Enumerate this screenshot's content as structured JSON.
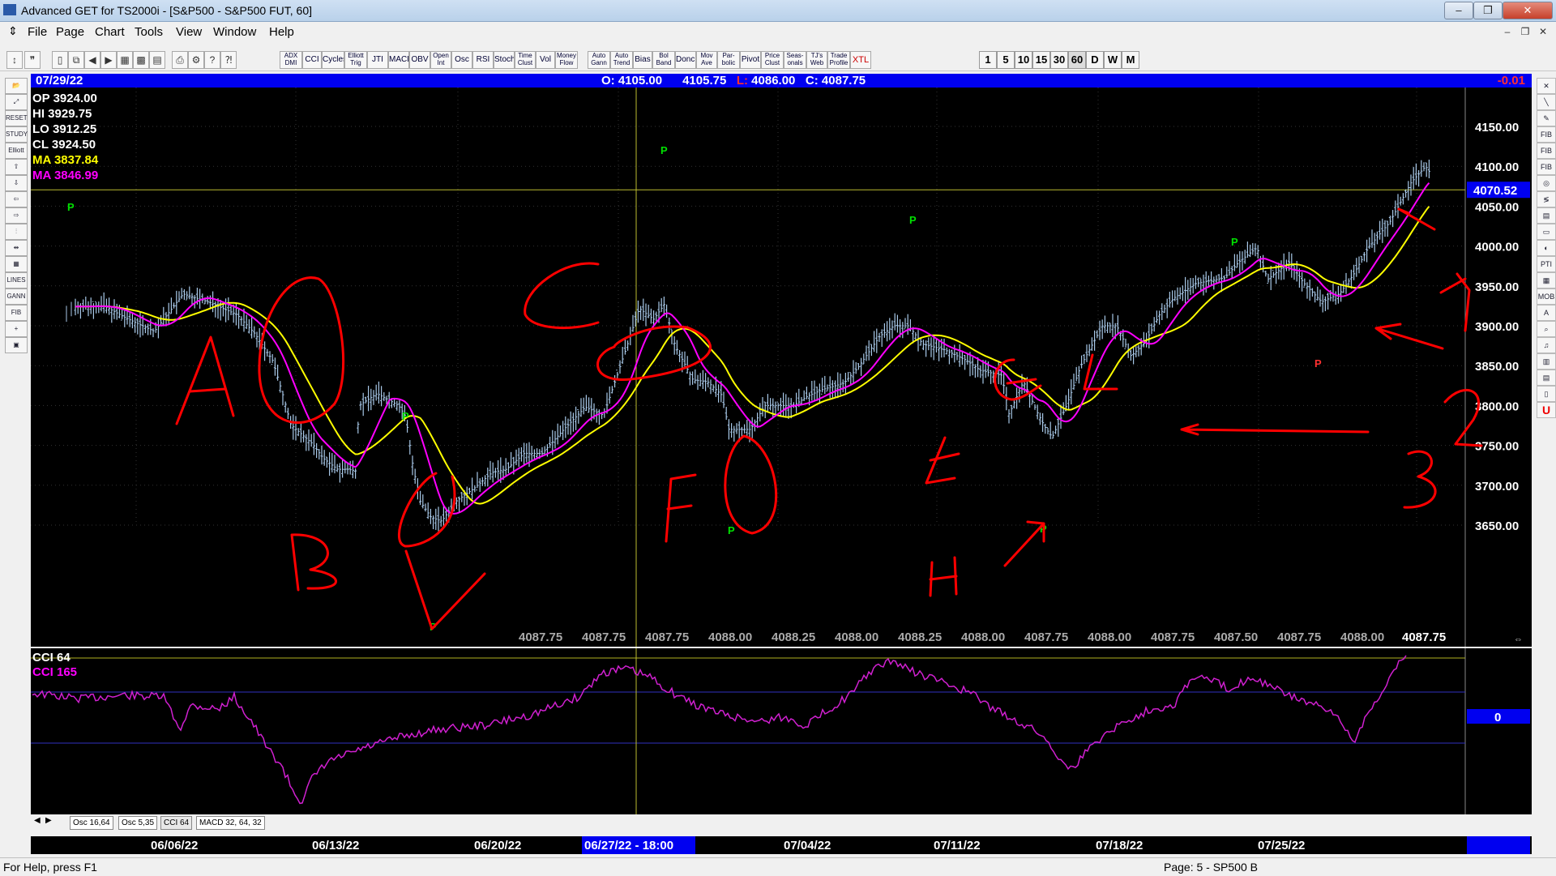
{
  "window": {
    "title": "Advanced GET for TS2000i - [S&P500 - S&P500 FUT, 60]",
    "controls": [
      "–",
      "❐",
      "✕"
    ]
  },
  "menu": [
    "File",
    "Page",
    "Chart",
    "Tools",
    "View",
    "Window",
    "Help"
  ],
  "toolbar": {
    "studies": [
      "ADX DMI",
      "CCI",
      "Cycles",
      "Elliott Trig",
      "JTI",
      "MACD",
      "OBV",
      "Open Int",
      "Osc",
      "RSI",
      "Stoch",
      "Time Clust",
      "Vol",
      "Money Flow",
      "Auto Gann",
      "Auto Trend",
      "Bias",
      "Bol Band",
      "Donch",
      "Mov Ave",
      "Par- bolic",
      "Pivot",
      "Price Clust",
      "Seas- onals",
      "TJ's Web",
      "Trade Profile",
      "XTL"
    ],
    "timeframes": [
      "1",
      "5",
      "10",
      "15",
      "30",
      "60",
      "D",
      "W",
      "M"
    ],
    "active_timeframe": "60"
  },
  "header": {
    "date": "07/29/22",
    "open": "O: 4105.00",
    "high": "4105.75",
    "low_label": "L:",
    "low": "4086.00",
    "close": "C: 4087.75",
    "change": "-0.01"
  },
  "legend": {
    "op": "OP  3924.00",
    "hi": "HI   3929.75",
    "lo": "LO  3912.25",
    "cl": "CL  3924.50",
    "ma1": "MA  3837.84",
    "ma2": "MA  3846.99"
  },
  "price_axis": {
    "ticks": [
      "4150.00",
      "4100.00",
      "4050.00",
      "4000.00",
      "3950.00",
      "3900.00",
      "3850.00",
      "3800.00",
      "3750.00",
      "3700.00",
      "3650.00"
    ],
    "current": "4070.52"
  },
  "bottom_values": [
    "4087.75",
    "4087.75",
    "4087.75",
    "4088.00",
    "4088.25",
    "4088.00",
    "4088.25",
    "4088.00",
    "4087.75",
    "4088.00",
    "4087.75",
    "4087.50",
    "4087.75",
    "4088.00",
    "4087.75"
  ],
  "pivot_label": "P",
  "cci": {
    "label1": "CCI 64",
    "label2": "CCI  165",
    "zero": "0"
  },
  "tabs": [
    "Osc 16,64",
    "Osc 5,35",
    "CCI 64",
    "MACD 32, 64, 32"
  ],
  "date_axis": {
    "labels": [
      "06/06/22",
      "06/13/22",
      "06/20/22",
      "06/27/22 - 18:00",
      "07/04/22",
      "07/11/22",
      "07/18/22",
      "07/25/22"
    ]
  },
  "annotations": {
    "letters": [
      "A",
      "B",
      "C",
      "F",
      "G",
      "H",
      "L",
      "1",
      "2",
      "3"
    ]
  },
  "status": {
    "left": "For Help, press F1",
    "right": "Page: 5 - SP500 B"
  },
  "colors": {
    "ma_yellow": "#ffff00",
    "ma_magenta": "#ff00ff",
    "bars": "#a8c8e8",
    "header_blue": "#0000f0",
    "pivot_green": "#00e000",
    "pivot_red": "#ff3030",
    "annotation_red": "#ff0000"
  }
}
